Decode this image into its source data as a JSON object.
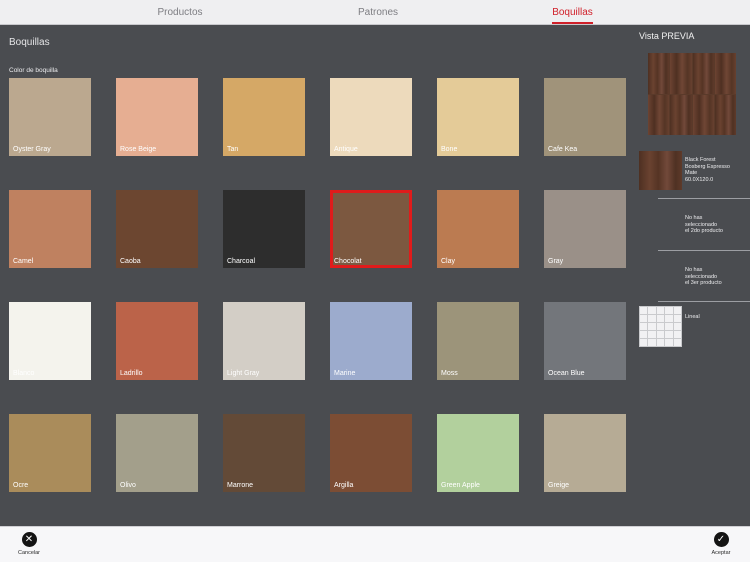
{
  "tabs": [
    {
      "label": "Productos",
      "active": false
    },
    {
      "label": "Patrones",
      "active": false
    },
    {
      "label": "Boquillas",
      "active": true
    }
  ],
  "main": {
    "title": "Boquillas",
    "group_label": "Color de boquilla",
    "selected": "Chocolat",
    "swatches": [
      {
        "name": "Oyster Gray",
        "color": "#bba88f"
      },
      {
        "name": "Rose Beige",
        "color": "#e6ae92"
      },
      {
        "name": "Tan",
        "color": "#d5a866"
      },
      {
        "name": "Antique",
        "color": "#eddabc"
      },
      {
        "name": "Bone",
        "color": "#e4cb98"
      },
      {
        "name": "Cafe Kea",
        "color": "#a0937a"
      },
      {
        "name": "Camel",
        "color": "#bf8160"
      },
      {
        "name": "Caoba",
        "color": "#6c4630"
      },
      {
        "name": "Charcoal",
        "color": "#2d2d2d"
      },
      {
        "name": "Chocolat",
        "color": "#7c5840"
      },
      {
        "name": "Clay",
        "color": "#bb7b51"
      },
      {
        "name": "Gray",
        "color": "#9a9088"
      },
      {
        "name": "Blanco",
        "color": "#f4f3ed"
      },
      {
        "name": "Ladrillo",
        "color": "#bb6349"
      },
      {
        "name": "Light Gray",
        "color": "#d3cec6"
      },
      {
        "name": "Marine",
        "color": "#9cabcd"
      },
      {
        "name": "Moss",
        "color": "#9c947a"
      },
      {
        "name": "Ocean Blue",
        "color": "#73767b"
      },
      {
        "name": "Ocre",
        "color": "#aa8c5b"
      },
      {
        "name": "Olivo",
        "color": "#a39f8b"
      },
      {
        "name": "Marrone",
        "color": "#634a37"
      },
      {
        "name": "Argilla",
        "color": "#7c4d34"
      },
      {
        "name": "Green Apple",
        "color": "#b2d09d"
      },
      {
        "name": "Greige",
        "color": "#b6ab95"
      }
    ]
  },
  "preview": {
    "title": "Vista PREVIA",
    "product1": {
      "line1": "Black Forest",
      "line2": "Bosberg Espresso",
      "line3": "Mate",
      "line4": "60.0X120.0"
    },
    "slot2": {
      "line1": "No has",
      "line2": "seleccionado",
      "line3": "el 2do producto"
    },
    "slot3": {
      "line1": "No has",
      "line2": "seleccionado",
      "line3": "el 3er producto"
    },
    "pattern_label": "Lineal"
  },
  "actions": {
    "cancel_label": "Cancelar",
    "cancel_icon": "close-icon",
    "accept_label": "Aceptar",
    "accept_icon": "checkmark-icon"
  }
}
